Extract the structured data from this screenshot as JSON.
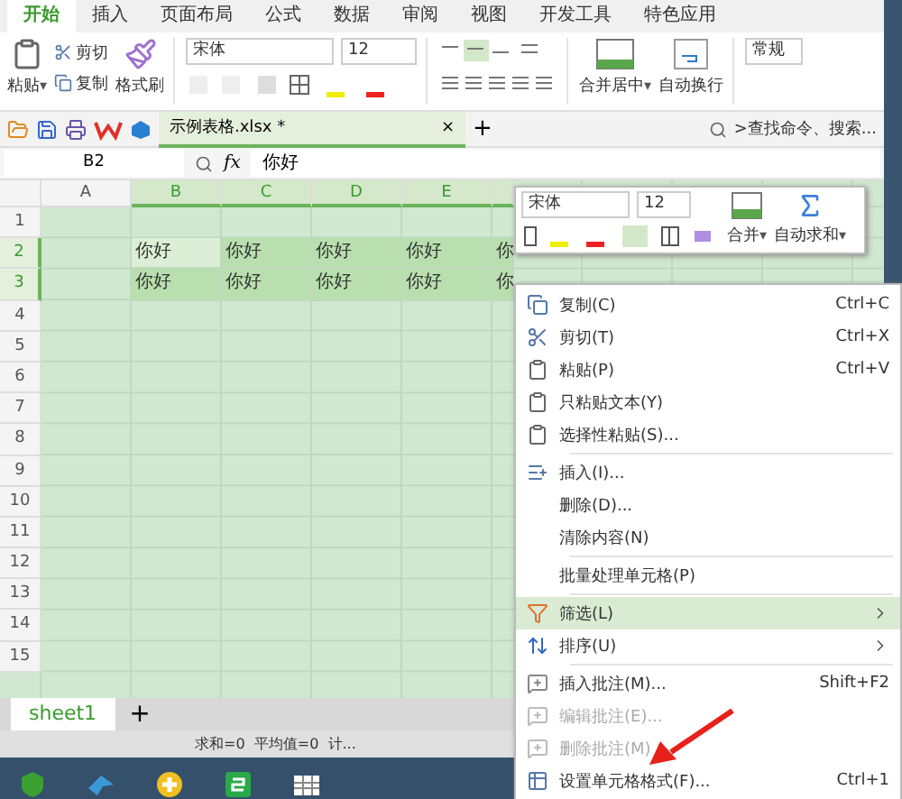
{
  "ribbon_tabs": [
    {
      "label": "开始",
      "selected": true
    },
    {
      "label": "插入",
      "selected": false
    },
    {
      "label": "页面布局",
      "selected": false
    },
    {
      "label": "公式",
      "selected": false
    },
    {
      "label": "数据",
      "selected": false
    },
    {
      "label": "审阅",
      "selected": false
    },
    {
      "label": "视图",
      "selected": false
    },
    {
      "label": "开发工具",
      "selected": false
    },
    {
      "label": "特色应用",
      "selected": false
    }
  ],
  "ribbon": {
    "paste": "粘贴",
    "paste_caret": "▾",
    "cut": "剪切",
    "copy": "复制",
    "format_painter": "格式刷",
    "font": "宋体",
    "size": "12",
    "merge": "合并居中",
    "merge_caret": "▾",
    "wrap": "自动换行",
    "number_format": "常规"
  },
  "document_tab": {
    "title": "示例表格.xlsx *",
    "close": "×",
    "add": "+"
  },
  "search": {
    "placeholder": ">查找命令、搜索..."
  },
  "formula_bar": {
    "cell": "B2",
    "fx": "fx",
    "value": "你好"
  },
  "sheet": {
    "columns": [
      "A",
      "B",
      "C",
      "D",
      "E"
    ],
    "rows": [
      {
        "label": "1",
        "selected": false,
        "cells": [
          "",
          "",
          "",
          "",
          "",
          ""
        ]
      },
      {
        "label": "2",
        "selected": true,
        "cells": [
          "",
          "你好",
          "你好",
          "你好",
          "你好",
          "你"
        ]
      },
      {
        "label": "3",
        "selected": true,
        "cells": [
          "",
          "你好",
          "你好",
          "你好",
          "你好",
          "你"
        ]
      },
      {
        "label": "4",
        "selected": false,
        "cells": [
          "",
          "",
          "",
          "",
          "",
          ""
        ]
      },
      {
        "label": "5",
        "selected": false,
        "cells": [
          "",
          "",
          "",
          "",
          "",
          ""
        ]
      },
      {
        "label": "6",
        "selected": false,
        "cells": [
          "",
          "",
          "",
          "",
          "",
          ""
        ]
      },
      {
        "label": "7",
        "selected": false,
        "cells": [
          "",
          "",
          "",
          "",
          "",
          ""
        ]
      },
      {
        "label": "8",
        "selected": false,
        "cells": [
          "",
          "",
          "",
          "",
          "",
          ""
        ]
      },
      {
        "label": "9",
        "selected": false,
        "cells": [
          "",
          "",
          "",
          "",
          "",
          ""
        ]
      },
      {
        "label": "10",
        "selected": false,
        "cells": [
          "",
          "",
          "",
          "",
          "",
          ""
        ]
      },
      {
        "label": "11",
        "selected": false,
        "cells": [
          "",
          "",
          "",
          "",
          "",
          ""
        ]
      },
      {
        "label": "12",
        "selected": false,
        "cells": [
          "",
          "",
          "",
          "",
          "",
          ""
        ]
      },
      {
        "label": "13",
        "selected": false,
        "cells": [
          "",
          "",
          "",
          "",
          "",
          ""
        ]
      },
      {
        "label": "14",
        "selected": false,
        "cells": [
          "",
          "",
          "",
          "",
          "",
          ""
        ]
      },
      {
        "label": "15",
        "selected": false,
        "cells": [
          "",
          "",
          "",
          "",
          "",
          ""
        ]
      }
    ]
  },
  "sheet_tabs": [
    {
      "label": "sheet1",
      "selected": true
    }
  ],
  "add_sheet": "+",
  "status_bar": {
    "text": "求和=0  平均值=0  计..."
  },
  "mini_toolbar": {
    "font": "宋体",
    "size": "12",
    "merge": "合并",
    "merge_caret": "▾",
    "autosum": "自动求和",
    "autosum_caret": "▾"
  },
  "context_menu": [
    {
      "kind": "item",
      "label": "复制(C)",
      "shortcut": "Ctrl+C",
      "disabled": false,
      "selected": false
    },
    {
      "kind": "item",
      "label": "剪切(T)",
      "shortcut": "Ctrl+X",
      "disabled": false,
      "selected": false
    },
    {
      "kind": "item",
      "label": "粘贴(P)",
      "shortcut": "Ctrl+V",
      "disabled": false,
      "selected": false
    },
    {
      "kind": "item",
      "label": "只粘贴文本(Y)",
      "disabled": false,
      "selected": false
    },
    {
      "kind": "item",
      "label": "选择性粘贴(S)...",
      "disabled": false,
      "selected": false
    },
    {
      "kind": "separator"
    },
    {
      "kind": "item",
      "label": "插入(I)...",
      "disabled": false,
      "selected": false
    },
    {
      "kind": "item",
      "label": "删除(D)...",
      "disabled": false,
      "selected": false
    },
    {
      "kind": "item",
      "label": "清除内容(N)",
      "disabled": false,
      "selected": false
    },
    {
      "kind": "separator"
    },
    {
      "kind": "item",
      "label": "批量处理单元格(P)",
      "disabled": false,
      "selected": false
    },
    {
      "kind": "separator"
    },
    {
      "kind": "submenu",
      "label": "筛选(L)",
      "disabled": false,
      "selected": true
    },
    {
      "kind": "submenu",
      "label": "排序(U)",
      "disabled": false,
      "selected": false
    },
    {
      "kind": "separator"
    },
    {
      "kind": "item",
      "label": "插入批注(M)...",
      "shortcut": "Shift+F2",
      "disabled": false,
      "selected": false
    },
    {
      "kind": "item",
      "label": "编辑批注(E)...",
      "disabled": true,
      "selected": false
    },
    {
      "kind": "item",
      "label": "删除批注(M)",
      "disabled": true,
      "selected": false
    },
    {
      "kind": "item",
      "label": "设置单元格格式(F)...",
      "shortcut": "Ctrl+1",
      "disabled": false,
      "selected": false
    }
  ]
}
